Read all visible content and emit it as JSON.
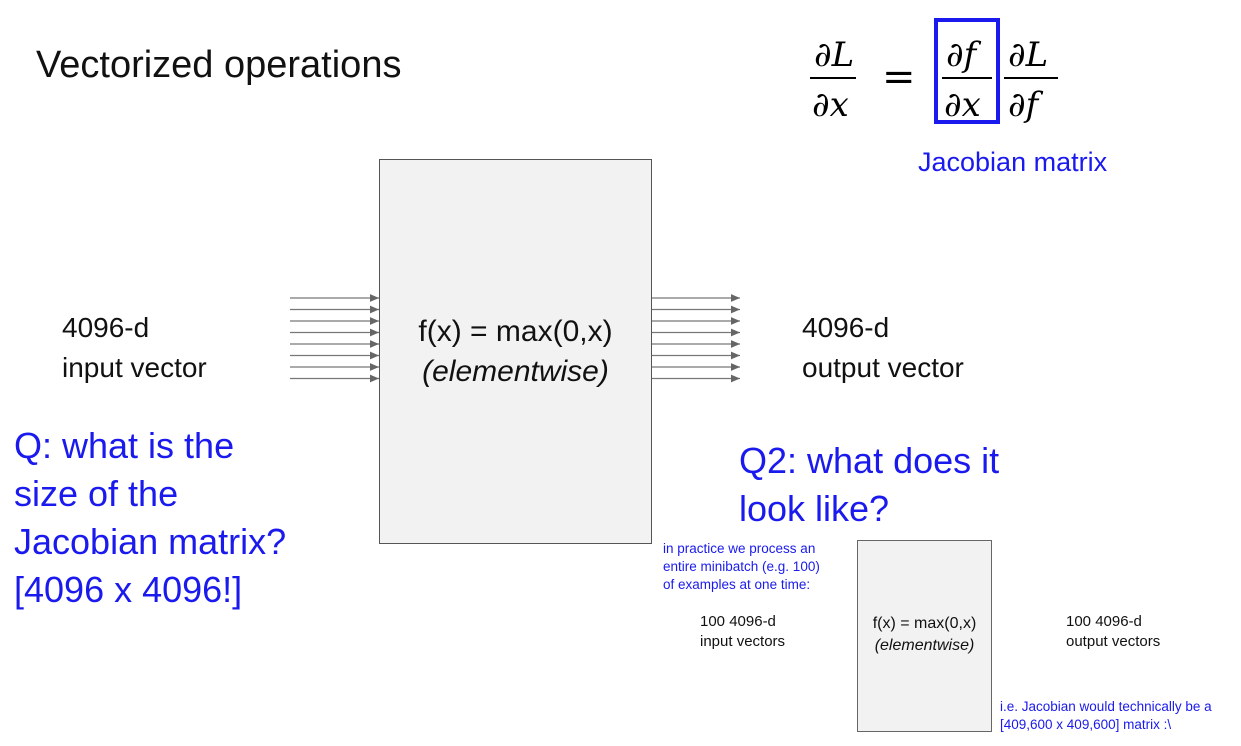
{
  "title": "Vectorized operations",
  "equation": {
    "lhs_num": "∂L",
    "lhs_den": "∂x",
    "equals": "=",
    "jac_num": "∂f",
    "jac_den": "∂x",
    "rhs_num": "∂L",
    "rhs_den": "∂f"
  },
  "jacobian_label": "Jacobian matrix",
  "main": {
    "input_label": [
      "4096-d",
      "input vector"
    ],
    "function_line1": "f(x) = max(0,x)",
    "function_line2": "(elementwise)",
    "output_label": [
      "4096-d",
      "output vector"
    ]
  },
  "q1": [
    "Q: what is the",
    "size of the",
    "Jacobian matrix?",
    "[4096 x 4096!]"
  ],
  "q2": [
    "Q2: what does it",
    "look like?"
  ],
  "inset": {
    "note": [
      "in practice we process an",
      "entire minibatch (e.g. 100)",
      "of examples at one time:"
    ],
    "input_label": [
      "100 4096-d",
      "input vectors"
    ],
    "function_line1": "f(x) = max(0,x)",
    "function_line2": "(elementwise)",
    "output_label": [
      "100 4096-d",
      "output vectors"
    ],
    "bottom_note": [
      "i.e. Jacobian would technically be a",
      "[409,600 x 409,600] matrix :\\"
    ]
  },
  "colors": {
    "accent": "#1a1aee",
    "box_fill": "#f2f2f2",
    "text": "#111111"
  }
}
